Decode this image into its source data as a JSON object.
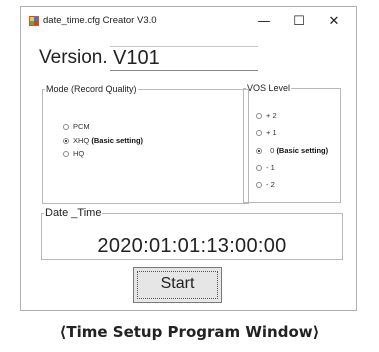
{
  "window": {
    "title": "date_time.cfg Creator V3.0",
    "minimize_glyph": "—",
    "maximize_glyph": "☐",
    "close_glyph": "✕",
    "app_icon": "app-icon"
  },
  "version": {
    "label": "Version.",
    "value": "V101"
  },
  "mode": {
    "legend": "Mode (Record Quality)",
    "options": [
      {
        "label": "PCM",
        "note": "",
        "checked": false
      },
      {
        "label": "XHQ",
        "note": "(Basic setting)",
        "checked": true
      },
      {
        "label": "HQ",
        "note": "",
        "checked": false
      }
    ]
  },
  "vos": {
    "legend": "VOS Level",
    "options": [
      {
        "label": "+ 2",
        "note": "",
        "checked": false
      },
      {
        "label": "+ 1",
        "note": "",
        "checked": false
      },
      {
        "label": "0",
        "note": "(Basic setting)",
        "checked": true
      },
      {
        "label": "- 1",
        "note": "",
        "checked": false
      },
      {
        "label": "- 2",
        "note": "",
        "checked": false
      }
    ]
  },
  "datetime": {
    "legend": "Date _Time",
    "value": "2020:01:01:13:00:00"
  },
  "start_button": {
    "label": "Start"
  },
  "caption": "⟨Time Setup Program Window⟩"
}
